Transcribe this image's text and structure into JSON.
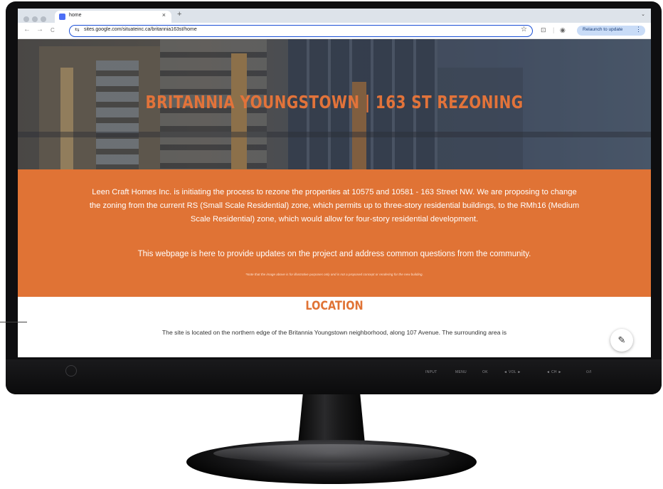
{
  "browser": {
    "tab_title": "home",
    "tab_close": "×",
    "new_tab": "+",
    "tab_menu": "⌄",
    "url": "sites.google.com/situateinc.ca/britannia163st/home",
    "relaunch_label": "Relaunch to update",
    "nav": {
      "back": "←",
      "forward": "→",
      "reload": "C"
    }
  },
  "hero": {
    "title": "BRITANNIA YOUNGSTOWN | 163 ST REZONING"
  },
  "intro": {
    "paragraph": "Leen Craft Homes Inc. is initiating the process to rezone the properties at 10575 and 10581 - 163 Street NW. We are proposing to change the zoning from the current RS (Small Scale Residential) zone, which permits up to three-story residential buildings, to the RMh16 (Medium Scale Residential) zone, which would allow for four-story residential development.",
    "purpose": "This webpage is here to provide updates on the project and address common questions from the community.",
    "note": "*Note that the image above is for illustrative purposes only and is not a proposed concept or rendering for the new building."
  },
  "location": {
    "title": "LOCATION",
    "text": "The site is located on the northern edge of the Britannia Youngstown neighborhood, along 107 Avenue. The surrounding area is"
  },
  "monitor": {
    "controls": [
      "INPUT",
      "MENU",
      "OK",
      "◄ VOL ►",
      "◄ CH ►",
      "⏻/I"
    ]
  },
  "colors": {
    "accent_orange": "#e07335",
    "hero_title": "#e2733a",
    "address_border": "#1a4fd6"
  }
}
